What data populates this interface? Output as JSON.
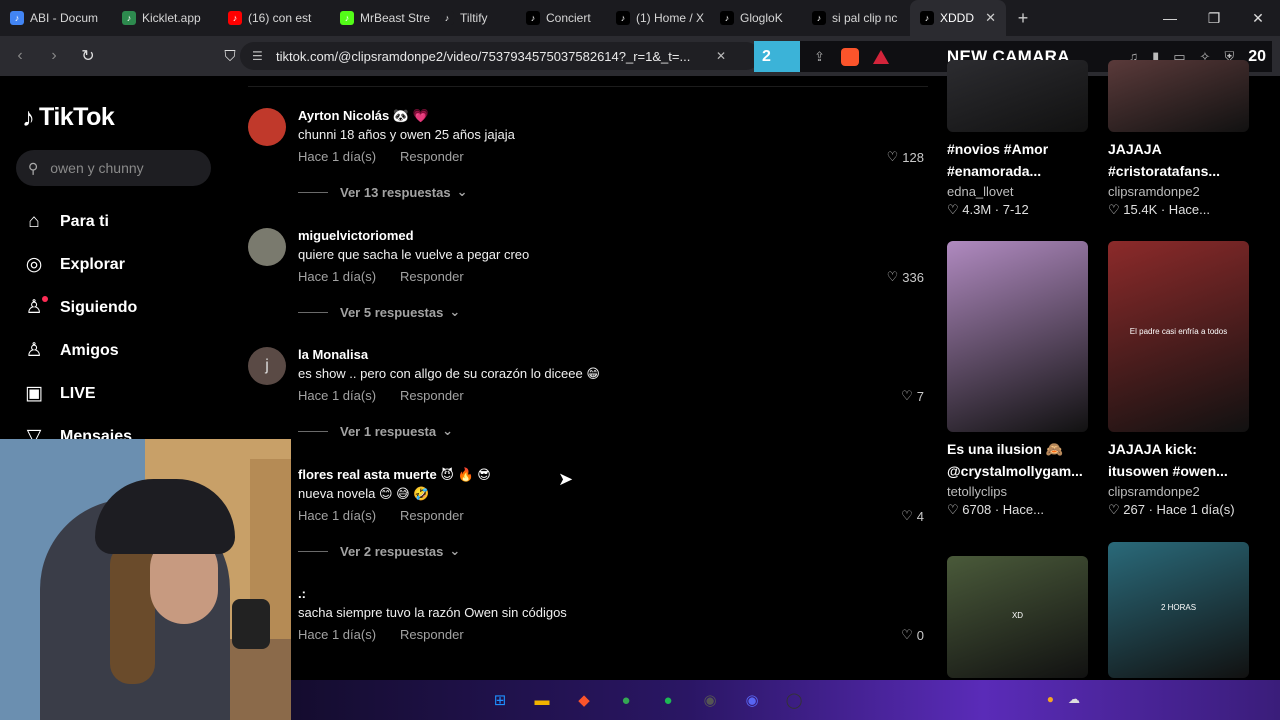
{
  "browser": {
    "tabs": [
      {
        "label": "ABI - Docum",
        "icon": "docs-icon",
        "color": "#4285f4"
      },
      {
        "label": "Kicklet.app",
        "icon": "kicklet-icon",
        "color": "#2d8a4e"
      },
      {
        "label": "(16) con est",
        "icon": "youtube-icon",
        "color": "#ff0000"
      },
      {
        "label": "MrBeast Stre",
        "icon": "kick-icon",
        "color": "#53fc18"
      },
      {
        "label": "Tiltify",
        "icon": "tiltify-icon",
        "color": "#1b1b1f"
      },
      {
        "label": "Conciert",
        "icon": "tiktok-icon",
        "color": "#000000"
      },
      {
        "label": "(1) Home / X",
        "icon": "x-icon",
        "color": "#000000"
      },
      {
        "label": "GlogloK",
        "icon": "tiktok-icon",
        "color": "#000000"
      },
      {
        "label": "si pal clip nc",
        "icon": "tiktok-icon",
        "color": "#000000"
      },
      {
        "label": "XDDD",
        "icon": "tiktok-icon",
        "color": "#000000",
        "active": true
      }
    ],
    "url": "tiktok.com/@clipsramdonpe2/video/7537934575037582614?_r=1&_t=...",
    "overlay": {
      "number": "2",
      "title": "NEW CAMARA",
      "count": "20"
    }
  },
  "sidebar": {
    "logo": "TikTok",
    "search_placeholder": "owen y chunny",
    "items": [
      {
        "label": "Para ti",
        "icon": "home-icon",
        "glyph": "⌂"
      },
      {
        "label": "Explorar",
        "icon": "compass-icon",
        "glyph": "◎"
      },
      {
        "label": "Siguiendo",
        "icon": "following-icon",
        "glyph": "♙"
      },
      {
        "label": "Amigos",
        "icon": "friends-icon",
        "glyph": "♙"
      },
      {
        "label": "LIVE",
        "icon": "live-icon",
        "glyph": "▣"
      },
      {
        "label": "Mensajes",
        "icon": "messages-icon",
        "glyph": "▽"
      }
    ]
  },
  "comments": [
    {
      "name": "Ayrton Nicolás 🐼 💗",
      "text": "chunni 18 años y owen 25 años jajaja",
      "time": "Hace 1 día(s)",
      "reply": "Responder",
      "likes": "128",
      "replies": "Ver 13 respuestas",
      "avatar_color": "#c0392b"
    },
    {
      "name": "miguelvictoriomed",
      "text": "quiere que sacha le vuelve a pegar creo",
      "time": "Hace 1 día(s)",
      "reply": "Responder",
      "likes": "336",
      "replies": "Ver 5 respuestas",
      "avatar_color": "#7a7a6e"
    },
    {
      "name": "la Monalisa",
      "text": "es show .. pero con allgo de su corazón lo diceee 😁",
      "time": "Hace 1 día(s)",
      "reply": "Responder",
      "likes": "7",
      "replies": "Ver 1 respuesta",
      "avatar_color": "#5a4a45",
      "avatar_letter": "j"
    },
    {
      "name": "flores real asta muerte 😈 🔥 😎",
      "text": "nueva novela 😊 😅 🤣",
      "time": "Hace 1 día(s)",
      "reply": "Responder",
      "likes": "4",
      "replies": "Ver 2 respuestas",
      "avatar_color": "#000000"
    },
    {
      "name": ".:",
      "text": "sacha siempre tuvo la razón Owen sin códigos",
      "time": "Hace 1 día(s)",
      "reply": "Responder",
      "likes": "0",
      "replies": "",
      "avatar_color": "#000000"
    }
  ],
  "videos": [
    {
      "title": "#novios #Amor #enamorada...",
      "author": "edna_llovet",
      "stats": "4.3M · 7-12",
      "color": "#2c2c30"
    },
    {
      "title": "JAJAJA #cristoratafans...",
      "author": "clipsramdonpe2",
      "stats": "15.4K · Hace...",
      "color": "#5a3a3a"
    },
    {
      "title": "Es una ilusion 🙈 @crystalmollygam...",
      "author": "tetollyclips",
      "stats": "6708 · Hace...",
      "color": "#b08ac0"
    },
    {
      "title": "JAJAJA kick: itusowen #owen...",
      "author": "clipsramdonpe2",
      "stats": "267 · Hace 1 día(s)",
      "color": "#8c2a2a",
      "overlay_text": "El padre casi enfría a todos"
    },
    {
      "title": "",
      "author": "",
      "stats": "",
      "color": "#4a5a3a",
      "overlay_text": "XD"
    },
    {
      "title": "",
      "author": "",
      "stats": "",
      "color": "#2a6a7a",
      "overlay_text": "2 HORAS"
    }
  ],
  "taskbar": {
    "apps": [
      {
        "icon": "windows-start-icon",
        "glyph": "⊞",
        "color": "#1e90ff"
      },
      {
        "icon": "file-explorer-icon",
        "glyph": "▬",
        "color": "#f2b300"
      },
      {
        "icon": "brave-icon",
        "glyph": "◆",
        "color": "#fb542b"
      },
      {
        "icon": "chrome-icon",
        "glyph": "●",
        "color": "#34a853"
      },
      {
        "icon": "spotify-icon",
        "glyph": "●",
        "color": "#1db954"
      },
      {
        "icon": "obs-icon",
        "glyph": "◉",
        "color": "#555555"
      },
      {
        "icon": "discord-icon",
        "glyph": "◉",
        "color": "#5865f2"
      },
      {
        "icon": "steam-icon",
        "glyph": "◯",
        "color": "#333333"
      }
    ]
  },
  "colors": {
    "accent": "#fe2c55",
    "muted": "#a3a3a3"
  }
}
